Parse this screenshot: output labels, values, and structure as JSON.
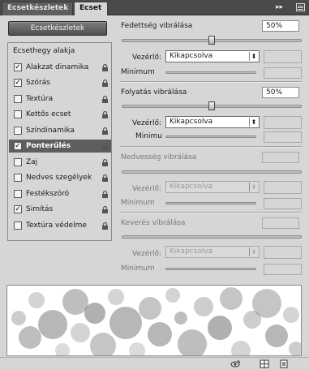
{
  "tabs": [
    "Ecsetkészletek",
    "Ecset"
  ],
  "header_buttons": {
    "collapse": "▸▸"
  },
  "presets_button": "Ecsetkészletek",
  "brush_settings": [
    {
      "label": "Ecsethegy alakja",
      "checked": false,
      "locked": false,
      "header": true
    },
    {
      "label": "Alakzat dinamika",
      "checked": true,
      "locked": true
    },
    {
      "label": "Szórás",
      "checked": true,
      "locked": true
    },
    {
      "label": "Textúra",
      "checked": false,
      "locked": true
    },
    {
      "label": "Kettős ecset",
      "checked": false,
      "locked": true
    },
    {
      "label": "Színdinamika",
      "checked": false,
      "locked": true
    },
    {
      "label": "Ponterűlés",
      "checked": true,
      "locked": true,
      "selected": true
    },
    {
      "label": "Zaj",
      "checked": false,
      "locked": true
    },
    {
      "label": "Nedves szegélyek",
      "checked": false,
      "locked": true
    },
    {
      "label": "Festékszóró",
      "checked": false,
      "locked": true
    },
    {
      "label": "Simítás",
      "checked": true,
      "locked": true
    },
    {
      "label": "Textúra védelme",
      "checked": false,
      "locked": true
    }
  ],
  "opacity_jitter": {
    "title": "Fedettség vibrálása",
    "value": "50%",
    "slider": 0.5,
    "control_label": "Vezérlő:",
    "control_value": "Kikapcsolva",
    "minimum_label": "Minimum"
  },
  "flow_jitter": {
    "title": "Folyatás vibrálása",
    "value": "50%",
    "slider": 0.5,
    "control_label": "Vezérlő:",
    "control_value": "Kikapcsolva",
    "minimum_label": "Minimu"
  },
  "wetness_jitter": {
    "title": "Nedvesség vibrálása",
    "value": "",
    "control_label": "Vezérlő:",
    "control_value": "Kikapcsolva",
    "minimum_label": "Minimum"
  },
  "mix_jitter": {
    "title": "Keverés vibrálása",
    "value": "",
    "control_label": "Vezérlő:",
    "control_value": "Kikapcsolva",
    "minimum_label": "Minimum"
  },
  "colors": {
    "selected_row": "#5e5e5e",
    "panel": "#d6d6d6",
    "tab_bar": "#4a4a4a"
  },
  "bottom_icons": [
    "eye-brush-icon",
    "grid-icon",
    "new-preset-icon"
  ]
}
